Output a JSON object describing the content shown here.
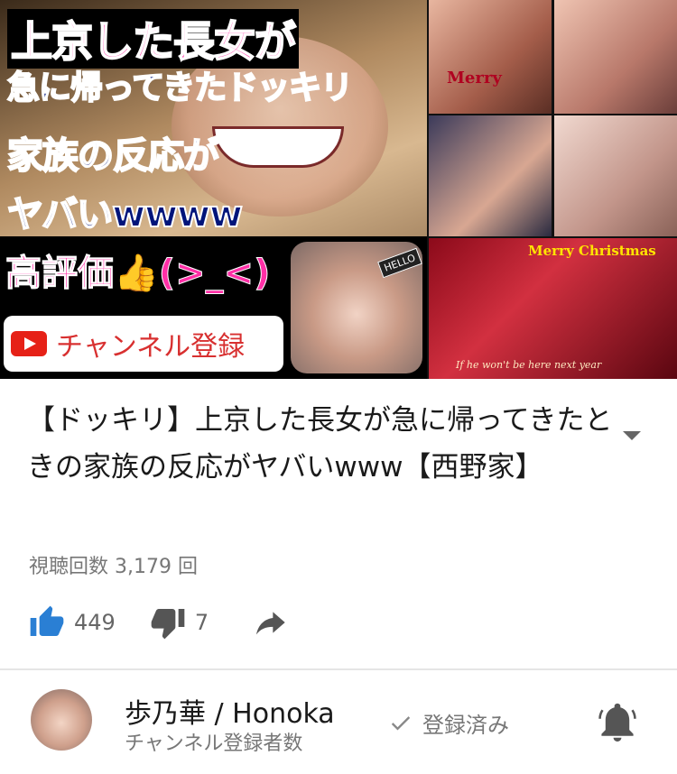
{
  "thumbnail": {
    "overlay_lines": [
      "上京した長女が",
      "急に帰ってきたドッキリ",
      "家族の反応が",
      "ヤバいwwww"
    ],
    "rating_text": "高評価👍(>_<)",
    "subscribe_text": "チャンネル登録",
    "hello_badge": "HELLO",
    "merry_text_1": "Merry",
    "merry_text_2": "Merry Christmas",
    "caption": "If he won't be here next year"
  },
  "video": {
    "title": "【ドッキリ】上京した長女が急に帰ってきたときの家族の反応がヤバいwww【西野家】",
    "views": "視聴回数 3,179 回",
    "likes": "449",
    "dislikes": "7"
  },
  "channel": {
    "name": "歩乃華 / Honoka",
    "subtitle": "チャンネル登録者数",
    "subscribed_label": "登録済み"
  },
  "colors": {
    "like_accent": "#2a7fd4",
    "icon_gray": "#555555",
    "text_secondary": "#777777"
  },
  "icons": [
    "thumb-up-icon",
    "thumb-down-icon",
    "share-icon",
    "check-icon",
    "bell-icon",
    "chevron-down-icon",
    "youtube-logo"
  ]
}
